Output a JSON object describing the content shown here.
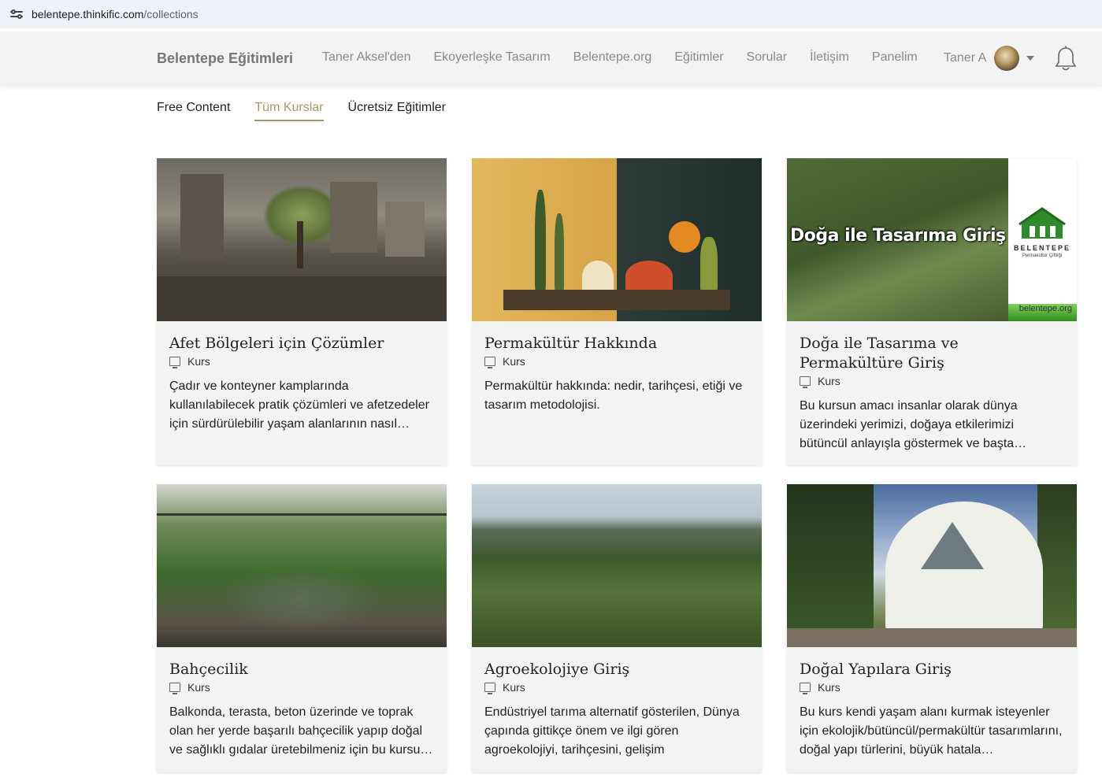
{
  "browser": {
    "url_host": "belentepe.thinkific.com",
    "url_path": "/collections"
  },
  "header": {
    "brand": "Belentepe Eğitimleri",
    "nav": [
      "Taner Aksel'den",
      "Ekoyerleşke Tasarım",
      "Belentepe.org",
      "Eğitimler",
      "Sorular",
      "İletişim",
      "Panelim"
    ],
    "user_name": "Taner A"
  },
  "tabs": [
    {
      "label": "Free Content",
      "active": false
    },
    {
      "label": "Tüm Kurslar",
      "active": true
    },
    {
      "label": "Ücretsiz Eğitimler",
      "active": false
    }
  ],
  "cards": [
    {
      "title": "Afet Bölgeleri için Çözümler",
      "kind": "Kurs",
      "description": "Çadır ve konteyner kamplarında kullanılabilecek pratik çözümleri ve afetzedeler için sürdürülebilir yaşam alanlarının nasıl…"
    },
    {
      "title": "Permakültür Hakkında",
      "kind": "Kurs",
      "description": "Permakültür hakkında: nedir, tarihçesi, etiği ve tasarım metodolojisi."
    },
    {
      "title": "Doğa ile Tasarıma ve Permakültüre Giriş",
      "kind": "Kurs",
      "description": "Bu kursun amacı insanlar olarak dünya üzerindeki yerimizi, doğaya etkilerimizi bütüncül anlayışla göstermek ve başta…",
      "image_text": "Doğa ile Tasarıma Giriş",
      "image_logo": "BELENTEPE",
      "image_logo_sub": "Permakültür Çiftliği",
      "image_url": "belentepe.org"
    },
    {
      "title": "Bahçecilik",
      "kind": "Kurs",
      "description": "Balkonda, terasta, beton üzerinde ve toprak olan her yerde başarılı bahçecilik yapıp doğal ve sağlıklı gıdalar üretebilmeniz için bu kursu…"
    },
    {
      "title": "Agroekolojiye Giriş",
      "kind": "Kurs",
      "description": "Endüstriyel tarıma alternatif gösterilen, Dünya çapında gittikçe önem ve ilgi gören agroekolojiyi, tarihçesini, gelişim potansiyelini…"
    },
    {
      "title": "Doğal Yapılara Giriş",
      "kind": "Kurs",
      "description": "Bu kurs kendi yaşam alanı kurmak isteyenler için ekolojik/bütüncül/permakültür tasarımlarını, doğal yapı türlerini, büyük hatala…"
    }
  ]
}
